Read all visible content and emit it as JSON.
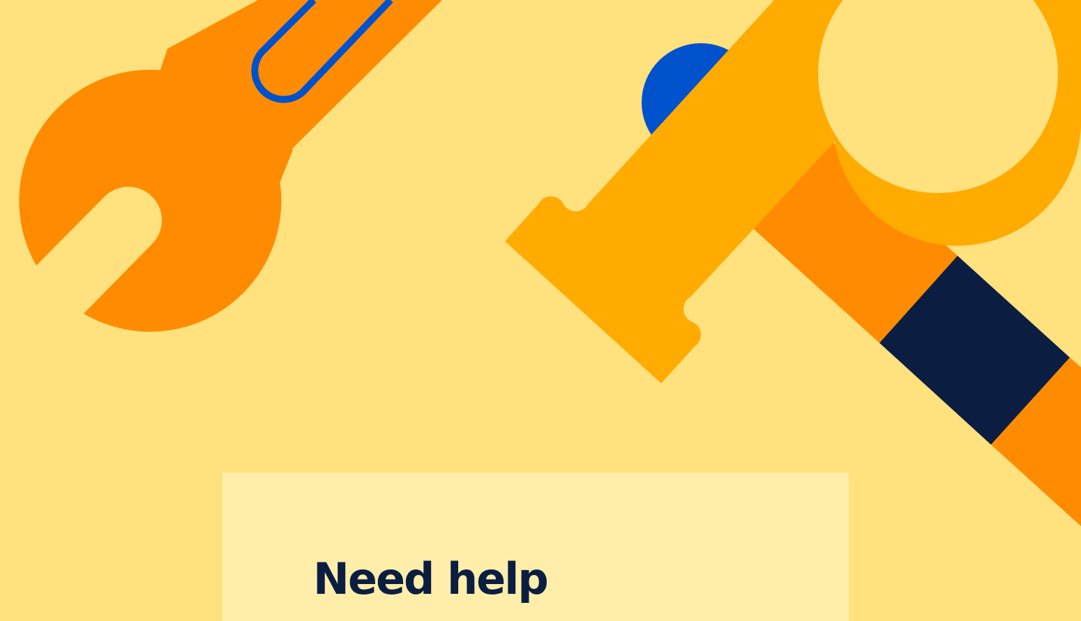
{
  "colors": {
    "background": "#ffe17e",
    "card_background": "#ffeea9",
    "wrench": "#ff8c00",
    "wrench_outline": "#0052cc",
    "hammer_head": "#ffab00",
    "hammer_handle": "#ff8c00",
    "handle_grip": "#0b1e42",
    "accent_circle": "#0052cc",
    "heading_text": "#0b1e42"
  },
  "illustration": {
    "wrench_icon": "wrench-icon",
    "hammer_icon": "hammer-icon",
    "circle_icon": "circle-icon"
  },
  "help_card": {
    "heading": "Need help"
  }
}
